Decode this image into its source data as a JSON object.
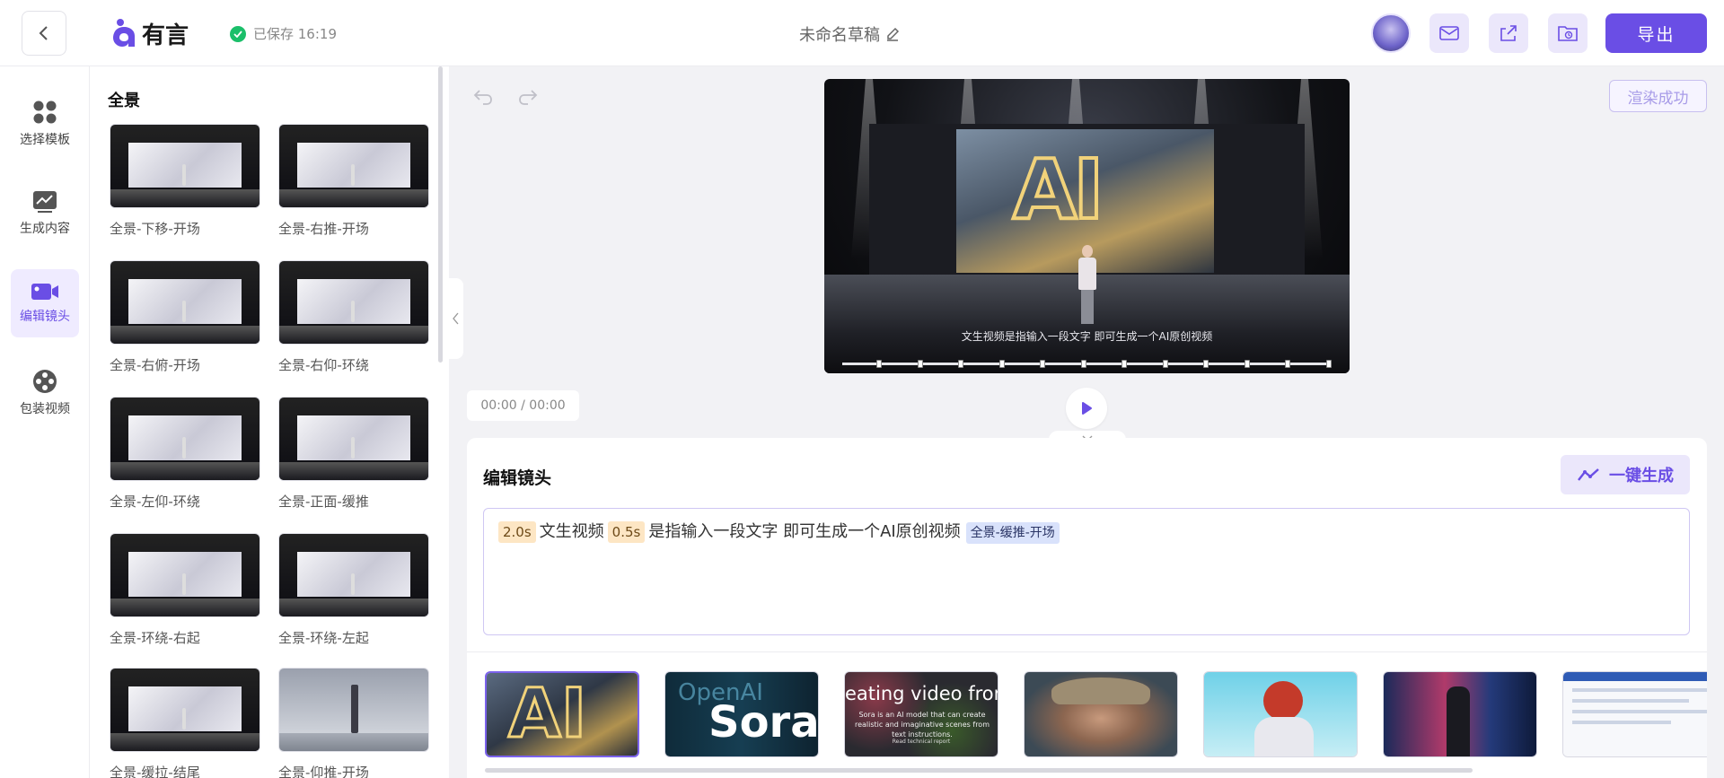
{
  "header": {
    "brand": "有言",
    "save_status": "已保存 16:19",
    "doc_title": "未命名草稿",
    "export_label": "导出"
  },
  "nav": [
    {
      "label": "选择模板",
      "icon": "grid-icon"
    },
    {
      "label": "生成内容",
      "icon": "chart-icon"
    },
    {
      "label": "编辑镜头",
      "icon": "camera-icon",
      "active": true
    },
    {
      "label": "包装视频",
      "icon": "film-reel-icon"
    }
  ],
  "panel": {
    "title": "全景",
    "items": [
      {
        "label": "全景-下移-开场"
      },
      {
        "label": "全景-右推-开场"
      },
      {
        "label": "全景-右俯-开场"
      },
      {
        "label": "全景-右仰-环绕"
      },
      {
        "label": "全景-左仰-环绕"
      },
      {
        "label": "全景-正面-缓推"
      },
      {
        "label": "全景-环绕-右起"
      },
      {
        "label": "全景-环绕-左起"
      },
      {
        "label": "全景-缓拉-结尾"
      },
      {
        "label": "全景-仰推-开场"
      }
    ]
  },
  "player": {
    "render_status": "渲染成功",
    "subtitle": "文生视频是指输入一段文字 即可生成一个AI原创视频",
    "timecode": "00:00 / 00:00",
    "marker_count": 12
  },
  "editor": {
    "title": "编辑镜头",
    "generate_label": "一键生成",
    "segments": {
      "t1": "2.0s",
      "text1": "文生视频",
      "t2": "0.5s",
      "text2": "是指输入一段文字 即可生成一个AI原创视频",
      "shot_tag": "全景-缓推-开场"
    }
  },
  "shots": [
    {
      "name": "ai-stage-shot",
      "text": "AI"
    },
    {
      "name": "openai-sora-shot",
      "text_top": "OpenAI",
      "text_main": "Sora"
    },
    {
      "name": "creating-video-shot",
      "text_main": "eating video from te",
      "text_sub": "Sora is an AI model that can create realistic and imaginative scenes from text instructions.",
      "text_foot": "Read technical report"
    },
    {
      "name": "old-man-portrait-shot"
    },
    {
      "name": "astronaut-shot"
    },
    {
      "name": "city-street-shot"
    },
    {
      "name": "webpage-shot"
    }
  ],
  "colors": {
    "accent": "#6a4ee5",
    "accent_soft": "#ebe7fb",
    "success": "#1bbf6a"
  }
}
